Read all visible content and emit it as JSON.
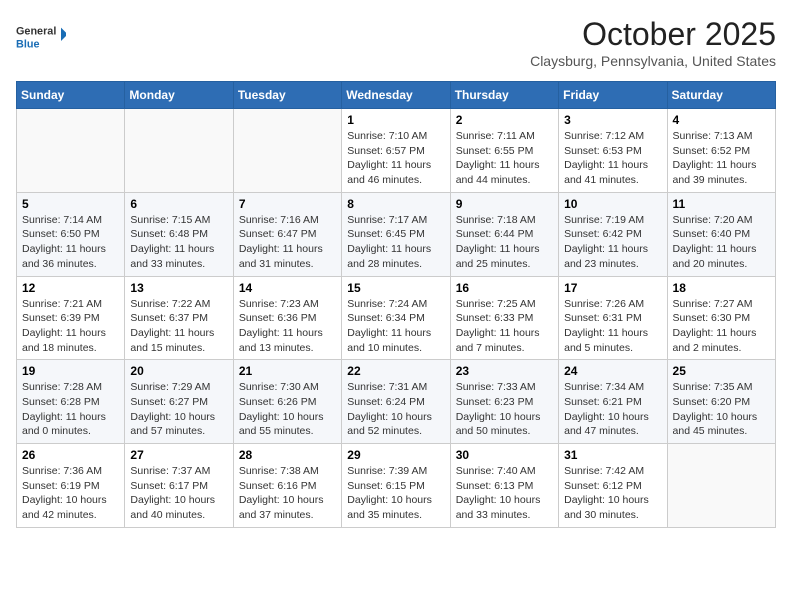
{
  "header": {
    "logo_line1": "General",
    "logo_line2": "Blue",
    "month_title": "October 2025",
    "location": "Claysburg, Pennsylvania, United States"
  },
  "days_of_week": [
    "Sunday",
    "Monday",
    "Tuesday",
    "Wednesday",
    "Thursday",
    "Friday",
    "Saturday"
  ],
  "weeks": [
    [
      {
        "day": "",
        "info": ""
      },
      {
        "day": "",
        "info": ""
      },
      {
        "day": "",
        "info": ""
      },
      {
        "day": "1",
        "info": "Sunrise: 7:10 AM\nSunset: 6:57 PM\nDaylight: 11 hours and 46 minutes."
      },
      {
        "day": "2",
        "info": "Sunrise: 7:11 AM\nSunset: 6:55 PM\nDaylight: 11 hours and 44 minutes."
      },
      {
        "day": "3",
        "info": "Sunrise: 7:12 AM\nSunset: 6:53 PM\nDaylight: 11 hours and 41 minutes."
      },
      {
        "day": "4",
        "info": "Sunrise: 7:13 AM\nSunset: 6:52 PM\nDaylight: 11 hours and 39 minutes."
      }
    ],
    [
      {
        "day": "5",
        "info": "Sunrise: 7:14 AM\nSunset: 6:50 PM\nDaylight: 11 hours and 36 minutes."
      },
      {
        "day": "6",
        "info": "Sunrise: 7:15 AM\nSunset: 6:48 PM\nDaylight: 11 hours and 33 minutes."
      },
      {
        "day": "7",
        "info": "Sunrise: 7:16 AM\nSunset: 6:47 PM\nDaylight: 11 hours and 31 minutes."
      },
      {
        "day": "8",
        "info": "Sunrise: 7:17 AM\nSunset: 6:45 PM\nDaylight: 11 hours and 28 minutes."
      },
      {
        "day": "9",
        "info": "Sunrise: 7:18 AM\nSunset: 6:44 PM\nDaylight: 11 hours and 25 minutes."
      },
      {
        "day": "10",
        "info": "Sunrise: 7:19 AM\nSunset: 6:42 PM\nDaylight: 11 hours and 23 minutes."
      },
      {
        "day": "11",
        "info": "Sunrise: 7:20 AM\nSunset: 6:40 PM\nDaylight: 11 hours and 20 minutes."
      }
    ],
    [
      {
        "day": "12",
        "info": "Sunrise: 7:21 AM\nSunset: 6:39 PM\nDaylight: 11 hours and 18 minutes."
      },
      {
        "day": "13",
        "info": "Sunrise: 7:22 AM\nSunset: 6:37 PM\nDaylight: 11 hours and 15 minutes."
      },
      {
        "day": "14",
        "info": "Sunrise: 7:23 AM\nSunset: 6:36 PM\nDaylight: 11 hours and 13 minutes."
      },
      {
        "day": "15",
        "info": "Sunrise: 7:24 AM\nSunset: 6:34 PM\nDaylight: 11 hours and 10 minutes."
      },
      {
        "day": "16",
        "info": "Sunrise: 7:25 AM\nSunset: 6:33 PM\nDaylight: 11 hours and 7 minutes."
      },
      {
        "day": "17",
        "info": "Sunrise: 7:26 AM\nSunset: 6:31 PM\nDaylight: 11 hours and 5 minutes."
      },
      {
        "day": "18",
        "info": "Sunrise: 7:27 AM\nSunset: 6:30 PM\nDaylight: 11 hours and 2 minutes."
      }
    ],
    [
      {
        "day": "19",
        "info": "Sunrise: 7:28 AM\nSunset: 6:28 PM\nDaylight: 11 hours and 0 minutes."
      },
      {
        "day": "20",
        "info": "Sunrise: 7:29 AM\nSunset: 6:27 PM\nDaylight: 10 hours and 57 minutes."
      },
      {
        "day": "21",
        "info": "Sunrise: 7:30 AM\nSunset: 6:26 PM\nDaylight: 10 hours and 55 minutes."
      },
      {
        "day": "22",
        "info": "Sunrise: 7:31 AM\nSunset: 6:24 PM\nDaylight: 10 hours and 52 minutes."
      },
      {
        "day": "23",
        "info": "Sunrise: 7:33 AM\nSunset: 6:23 PM\nDaylight: 10 hours and 50 minutes."
      },
      {
        "day": "24",
        "info": "Sunrise: 7:34 AM\nSunset: 6:21 PM\nDaylight: 10 hours and 47 minutes."
      },
      {
        "day": "25",
        "info": "Sunrise: 7:35 AM\nSunset: 6:20 PM\nDaylight: 10 hours and 45 minutes."
      }
    ],
    [
      {
        "day": "26",
        "info": "Sunrise: 7:36 AM\nSunset: 6:19 PM\nDaylight: 10 hours and 42 minutes."
      },
      {
        "day": "27",
        "info": "Sunrise: 7:37 AM\nSunset: 6:17 PM\nDaylight: 10 hours and 40 minutes."
      },
      {
        "day": "28",
        "info": "Sunrise: 7:38 AM\nSunset: 6:16 PM\nDaylight: 10 hours and 37 minutes."
      },
      {
        "day": "29",
        "info": "Sunrise: 7:39 AM\nSunset: 6:15 PM\nDaylight: 10 hours and 35 minutes."
      },
      {
        "day": "30",
        "info": "Sunrise: 7:40 AM\nSunset: 6:13 PM\nDaylight: 10 hours and 33 minutes."
      },
      {
        "day": "31",
        "info": "Sunrise: 7:42 AM\nSunset: 6:12 PM\nDaylight: 10 hours and 30 minutes."
      },
      {
        "day": "",
        "info": ""
      }
    ]
  ]
}
